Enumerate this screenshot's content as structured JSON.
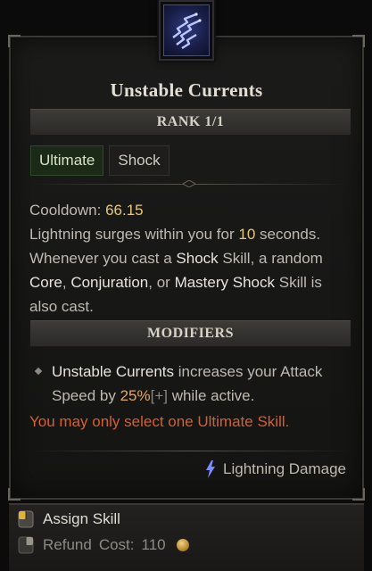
{
  "skill": {
    "name": "Unstable Currents",
    "icon": "lightning-bolts-icon",
    "rank_label": "RANK 1/1",
    "tags": [
      "Ultimate",
      "Shock"
    ]
  },
  "description": {
    "cooldown_label": "Cooldown:",
    "cooldown_value": "66.15",
    "line_a": "Lightning surges within you for ",
    "duration": "10",
    "line_b": " seconds. Whenever you cast a ",
    "shock": "Shock",
    "line_c": " Skill, a random ",
    "core": "Core",
    "sep1": ", ",
    "conjuration": "Conjuration",
    "sep2": ", or ",
    "mastery": "Mastery",
    "line_d": " ",
    "shock2": "Shock",
    "line_e": " Skill is also cast."
  },
  "modifiers": {
    "header": "MODIFIERS",
    "skill_ref": "Unstable Currents",
    "text_a": " increases your Attack Speed by ",
    "value": "25%",
    "bracket": "[+]",
    "text_b": " while active."
  },
  "warning": "You may only select one Ultimate Skill.",
  "damage_type": {
    "icon": "lightning-icon",
    "label": "Lightning Damage"
  },
  "footer": {
    "assign_label": "Assign Skill",
    "refund_label": "Refund",
    "cost_label": "Cost:",
    "cost_value": "110",
    "currency_icon": "gold-coin-icon"
  },
  "colors": {
    "title": "#e4dfd4",
    "highlight_number": "#e3c77a",
    "warning": "#d4602f",
    "modifier_value": "#e3a66a",
    "ultimate_tag_bg": "#1a2a17"
  }
}
